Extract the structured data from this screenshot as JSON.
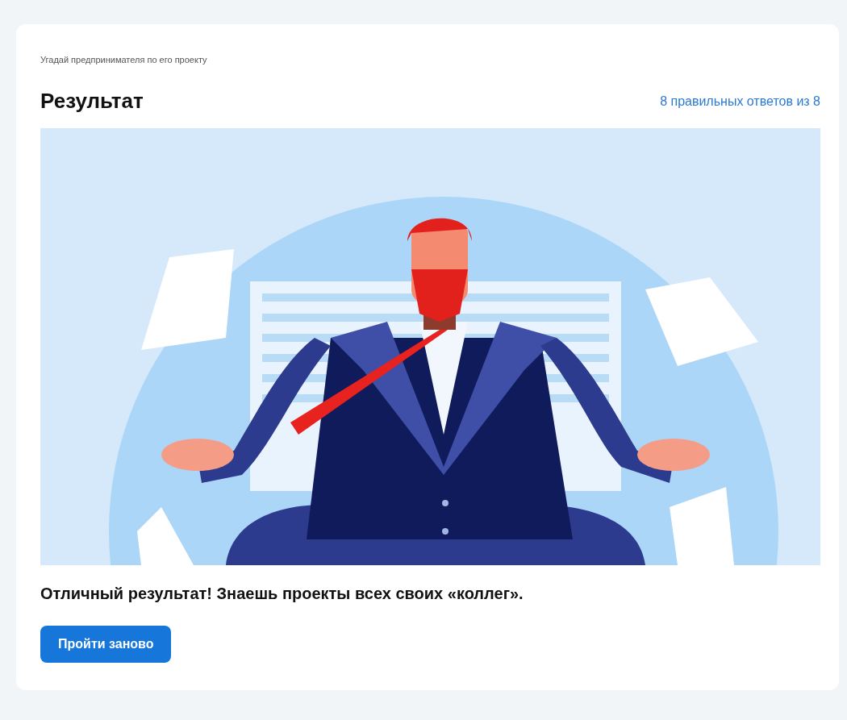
{
  "quiz": {
    "caption": "Угадай предпринимателя по его проекту",
    "title": "Результат",
    "score": "8 правильных ответов из 8"
  },
  "result": {
    "message": "Отличный результат! Знаешь проекты всех своих «коллег».",
    "button": "Пройти заново"
  }
}
